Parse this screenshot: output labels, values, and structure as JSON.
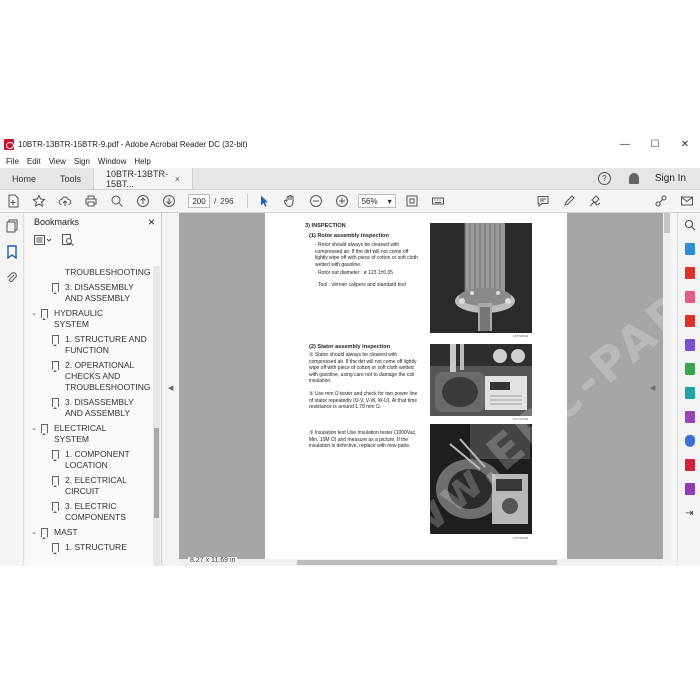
{
  "window": {
    "title": "10BTR-13BTR-15BTR-9.pdf - Adobe Acrobat Reader DC (32-bit)",
    "min": "—",
    "max": "☐",
    "close": "✕"
  },
  "menu": [
    "File",
    "Edit",
    "View",
    "Sign",
    "Window",
    "Help"
  ],
  "tabs": {
    "home": "Home",
    "tools": "Tools",
    "doc": "10BTR-13BTR-15BT...",
    "doc_close": "×",
    "help": "?",
    "signin": "Sign In"
  },
  "toolbar": {
    "page_current": "200",
    "page_sep": "/",
    "page_total": "296",
    "zoom": "56%",
    "zoom_caret": "▾"
  },
  "bookmarks": {
    "title": "Bookmarks",
    "close": "×",
    "items": [
      {
        "level": 2,
        "label": "CHECKS AND TROUBLESHOOTING",
        "caret": ""
      },
      {
        "level": 2,
        "label": "3. DISASSEMBLY AND ASSEMBLY",
        "caret": ""
      },
      {
        "level": 1,
        "label": "HYDRAULIC SYSTEM",
        "caret": "⌄"
      },
      {
        "level": 2,
        "label": "1. STRUCTURE AND FUNCTION",
        "caret": ""
      },
      {
        "level": 2,
        "label": "2. OPERATIONAL CHECKS AND TROUBLESHOOTING",
        "caret": ""
      },
      {
        "level": 2,
        "label": "3. DISASSEMBLY AND ASSEMBLY",
        "caret": ""
      },
      {
        "level": 1,
        "label": "ELECTRICAL SYSTEM",
        "caret": "⌄"
      },
      {
        "level": 2,
        "label": "1. COMPONENT LOCATION",
        "caret": ""
      },
      {
        "level": 2,
        "label": "2. ELECTRICAL CIRCUIT",
        "caret": ""
      },
      {
        "level": 2,
        "label": "3. ELECTRIC COMPONENTS",
        "caret": ""
      },
      {
        "level": 1,
        "label": "MAST",
        "caret": "⌄"
      },
      {
        "level": 2,
        "label": "1. STRUCTURE",
        "caret": ""
      }
    ]
  },
  "status": {
    "page_size": "8.27 x 11.69 in"
  },
  "document": {
    "section": "3) INSPECTION",
    "rotor_title": "(1) Rotor assembly inspection",
    "rotor_p1": "· Rotor should always be cleaned with compressed air. If the dirt will not come off lightly wipe off with piece of cotton or soft cloth wetted with gasoline.",
    "rotor_p2": "· Rotor out diameter : ø 123.1±0.05",
    "rotor_p3": "· Tool : Vernier calipers and standard tool",
    "stator_title": "(2) Stator assembly inspection",
    "stator_p1": "① Stator should always be cleaned with compressed air. If the dirt will not come off lightly wipe off with piece of cotton or soft cloth wetted with gasoline, using care not to damage the coil insulation.",
    "stator_p2": "② Use mm Ω tester and check for two power line of stator repeatedly (U-V, V-W, W-U). At that time resistance is around 1.78 mm Ω.",
    "stator_p3": "③ Insulation test Use Insulation tester (1000Vac, Min. 10M Ω) and measure as a picture. If the insulation is defective, replace with new parts.",
    "cap1": "1DTNPN01",
    "cap2": "1DTNPN02",
    "cap3": "1DTNPN03",
    "watermark": "www.EPC-PARTS.COM"
  },
  "colors": {
    "accent": "#1a5fb4",
    "acrobat_red": "#c8102e",
    "doc_bg": "#a6a6a6"
  }
}
